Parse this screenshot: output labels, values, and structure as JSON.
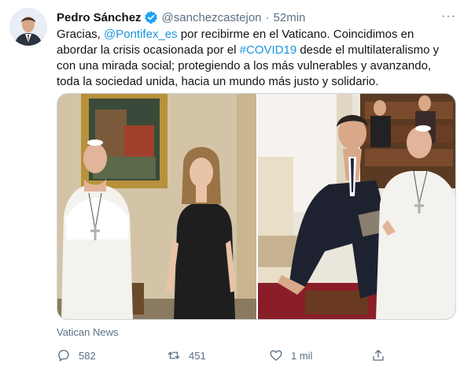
{
  "author": {
    "name": "Pedro Sánchez",
    "handle": "@sanchezcastejon",
    "separator": "·",
    "time": "52min"
  },
  "more_glyph": "···",
  "tweet": {
    "p1": "Gracias, ",
    "mention": "@Pontifex_es",
    "p2": " por recibirme en el Vaticano. Coincidimos en abordar la crisis ocasionada por el ",
    "hashtag": "#COVID19",
    "p3": " desde el multilateralismo y con una mirada social; protegiendo a los más vulnerables y avanzando, toda la sociedad unida, hacia un mundo más justo y solidario."
  },
  "media_source": "Vatican News",
  "actions": {
    "replies": "582",
    "retweets": "451",
    "likes": "1 mil"
  },
  "colors": {
    "link": "#1b95e0",
    "verified": "#1da1f2",
    "secondary_text": "#5b7083"
  },
  "icons": [
    "verified-badge-icon",
    "more-options-icon",
    "reply-icon",
    "retweet-icon",
    "like-icon",
    "share-icon"
  ]
}
